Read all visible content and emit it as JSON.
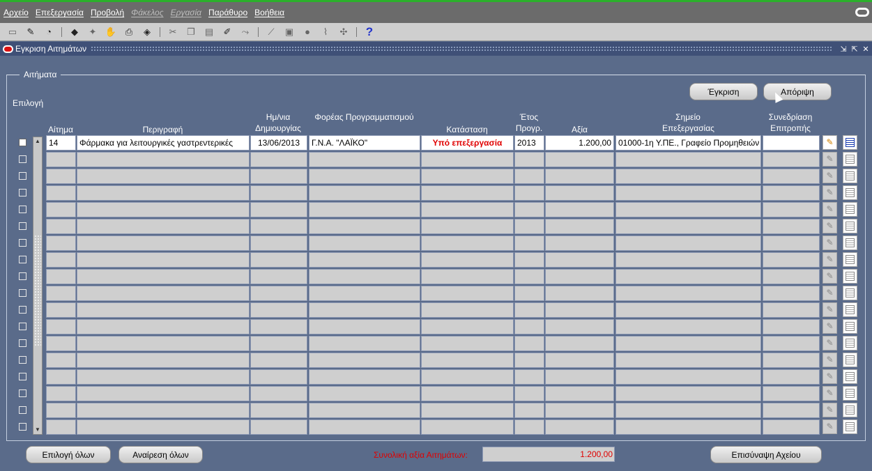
{
  "menu": [
    "Αρχείο",
    "Επεξεργασία",
    "Προβολή",
    "Φάκελος",
    "Εργασία",
    "Παράθυρο",
    "Βοήθεια"
  ],
  "toolbar_icons": [
    "save-icon",
    "open-icon",
    "history-icon",
    "new-record-icon",
    "clear-icon",
    "delete-icon",
    "print-icon",
    "attach-icon",
    "cut-icon",
    "copy-icon",
    "paste-icon",
    "edit-icon",
    "zoom-icon",
    "query-icon",
    "lov-icon",
    "block-icon",
    "help-icon"
  ],
  "window": {
    "title": "Εγκριση Αιτημάτων"
  },
  "panel": {
    "title": "Αιτήματα"
  },
  "buttons": {
    "approve": "Έγκριση",
    "reject": "Απόριψη",
    "select_all": "Επιλογή όλων",
    "deselect_all": "Αναίρεση όλων",
    "attach_file": "Επισύναψη Αχείου"
  },
  "selection_label": "Επιλογή",
  "columns": {
    "request": "Αίτημα",
    "description": "Περιγραφή",
    "created_date": "Ημ/νια Δημιουργίας",
    "planning_body": "Φορέας Προγραμματισμού",
    "status": "Κατάσταση",
    "program_year": "Έτος Προγρ.",
    "value": "Αξία",
    "processing_point": "Σημείο Επεξεργασίας",
    "committee_meeting": "Συνεδρίαση Επιτροπής"
  },
  "rows": [
    {
      "request": "14",
      "description": "Φάρμακα για λειτουργικές γαστρεντερικές",
      "created_date": "13/06/2013",
      "planning_body": "Γ.Ν.Α. \"ΛΑΪΚΟ\"",
      "status": "Υπό επεξεργασία",
      "program_year": "2013",
      "value": "1.200,00",
      "processing_point": "01000-1η Υ.ΠΕ., Γραφείο Προμηθειών",
      "committee_meeting": ""
    }
  ],
  "total": {
    "label": "Συνολική αξία Αιτημάτων:",
    "value": "1.200,00"
  },
  "colors": {
    "background": "#5a6b8a",
    "status_red": "#e00000",
    "menubar": "#6b6b6b"
  }
}
